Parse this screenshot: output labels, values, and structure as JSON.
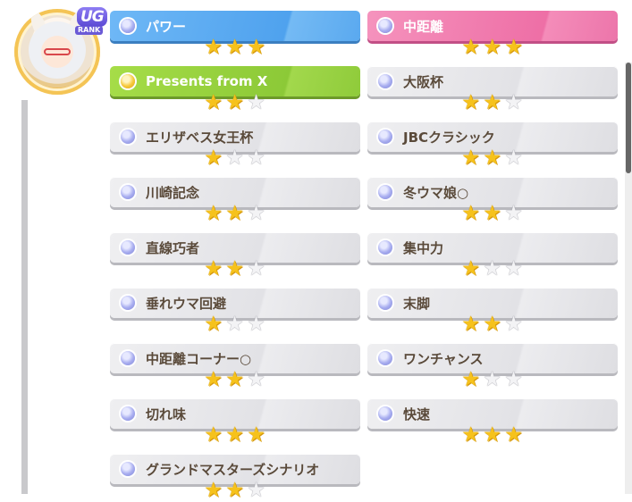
{
  "profile": {
    "rank_badge": "UG",
    "rank_label": "RANK"
  },
  "skills": [
    {
      "name": "パワー",
      "stars": 3,
      "max_stars": 3,
      "style": "blue"
    },
    {
      "name": "中距離",
      "stars": 3,
      "max_stars": 3,
      "style": "pink"
    },
    {
      "name": "Presents from X",
      "stars": 2,
      "max_stars": 3,
      "style": "green"
    },
    {
      "name": "大阪杯",
      "stars": 2,
      "max_stars": 3,
      "style": "gray"
    },
    {
      "name": "エリザベス女王杯",
      "stars": 1,
      "max_stars": 3,
      "style": "gray"
    },
    {
      "name": "JBCクラシック",
      "stars": 2,
      "max_stars": 3,
      "style": "gray"
    },
    {
      "name": "川崎記念",
      "stars": 2,
      "max_stars": 3,
      "style": "gray"
    },
    {
      "name": "冬ウマ娘○",
      "stars": 2,
      "max_stars": 3,
      "style": "gray"
    },
    {
      "name": "直線巧者",
      "stars": 2,
      "max_stars": 3,
      "style": "gray"
    },
    {
      "name": "集中力",
      "stars": 1,
      "max_stars": 3,
      "style": "gray"
    },
    {
      "name": "垂れウマ回避",
      "stars": 1,
      "max_stars": 3,
      "style": "gray"
    },
    {
      "name": "末脚",
      "stars": 2,
      "max_stars": 3,
      "style": "gray"
    },
    {
      "name": "中距離コーナー○",
      "stars": 2,
      "max_stars": 3,
      "style": "gray"
    },
    {
      "name": "ワンチャンス",
      "stars": 1,
      "max_stars": 3,
      "style": "gray"
    },
    {
      "name": "切れ味",
      "stars": 3,
      "max_stars": 3,
      "style": "gray"
    },
    {
      "name": "快速",
      "stars": 3,
      "max_stars": 3,
      "style": "gray"
    },
    {
      "name": "グランドマスターズシナリオ",
      "stars": 2,
      "max_stars": 3,
      "style": "gray"
    }
  ]
}
